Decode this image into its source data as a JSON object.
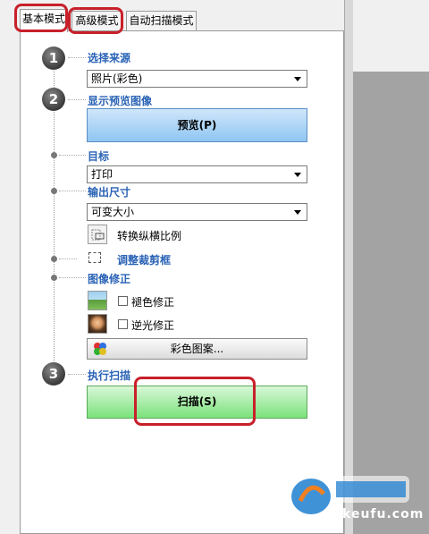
{
  "tabs": [
    {
      "label": "基本模式"
    },
    {
      "label": "高级模式"
    },
    {
      "label": "自动扫描模式"
    }
  ],
  "steps": {
    "step1_number": "1",
    "step2_number": "2",
    "step3_number": "3"
  },
  "source": {
    "label": "选择来源",
    "value": "照片(彩色)"
  },
  "preview": {
    "label": "显示预览图像",
    "button": "预览(P)"
  },
  "target": {
    "label": "目标",
    "value": "打印"
  },
  "output_size": {
    "label": "输出尺寸",
    "value": "可变大小",
    "swap_aspect": "转换纵横比例"
  },
  "crop": {
    "label": "调整裁剪框"
  },
  "correction": {
    "label": "图像修正",
    "fade": "褪色修正",
    "backlight": "逆光修正",
    "color_pattern": "彩色图案..."
  },
  "scan": {
    "label": "执行扫描",
    "button": "扫描(S)"
  },
  "watermark": {
    "text": "qkeufu.com"
  },
  "colors": {
    "accent_blue": "#2a63b5",
    "highlight_red": "#c8202a",
    "scan_green": "#7be27b"
  }
}
